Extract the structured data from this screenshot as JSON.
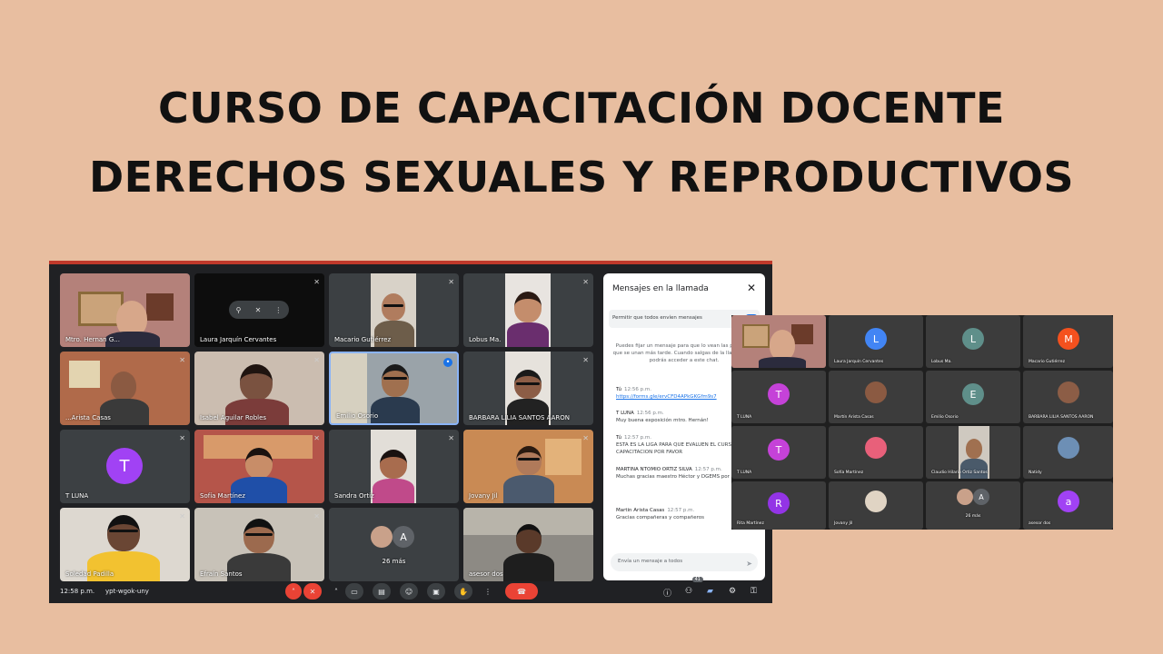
{
  "title_line1": "CURSO DE CAPACITACIÓN DOCENTE",
  "title_line2": "DERECHOS SEXUALES Y REPRODUCTIVOS",
  "meet1": {
    "participants": [
      {
        "name": "Mtro. Hernan G..."
      },
      {
        "name": "Laura Jarquín Cervantes"
      },
      {
        "name": "Macario Gutiérrez"
      },
      {
        "name": "Lobus Ma."
      },
      {
        "name": "...Arista Casas"
      },
      {
        "name": "Isabel Aguilar Robles"
      },
      {
        "name": "Emilio Osorio"
      },
      {
        "name": "BARBARA LILIA SANTOS AARON"
      },
      {
        "name": "T LUNA",
        "initial": "T"
      },
      {
        "name": "Sofía Martínez"
      },
      {
        "name": "Sandra Ortiz"
      },
      {
        "name": "Jovany Jil"
      },
      {
        "name": "Soledad Padilla"
      },
      {
        "name": "Efraín Santos"
      },
      {
        "name": "26 más",
        "initial": "A"
      },
      {
        "name": "asesor dos"
      }
    ],
    "chat": {
      "header": "Mensajes en la llamada",
      "permission": "Permitir que todos envíen mensajes",
      "info": "Puedes fijar un mensaje para que lo vean las personas que se unan más tarde. Cuando salgas de la llamada, no podrás acceder a este chat.",
      "messages": [
        {
          "sender": "Tú",
          "time": "12:56 p.m.",
          "text": "https://forms.gle/ervCFD4APkGKGfm9s7",
          "link": true
        },
        {
          "sender": "T LUNA",
          "time": "12:56 p.m.",
          "text": "Muy buena exposición mtro. Hernán!"
        },
        {
          "sender": "Tú",
          "time": "12:57 p.m.",
          "text": "ESTA ES LA LIGA PARA QUE EVALUEN EL CURSO DE CAPACITACION POR FAVOR"
        },
        {
          "sender": "MARTINA NTOMIO ORTIZ SILVA",
          "time": "12:57 p.m.",
          "text": "Muchas gracias maestro Héctor y DGEMS por su apoyo"
        },
        {
          "sender": "Martin Arista Casas",
          "time": "12:57 p.m.",
          "text": "Gracias compañeras y compañeros"
        }
      ],
      "input_placeholder": "Envía un mensaje a todos"
    },
    "bottom_bar": {
      "time": "12:58 p.m.",
      "meeting_code": "ypt-wgok-uny",
      "participant_count": "41"
    }
  },
  "meet2": {
    "participants": [
      {
        "name": ""
      },
      {
        "name": "Laura Jarquín Cervantes",
        "initial": "L"
      },
      {
        "name": "Lobus Ma.",
        "initial": "L"
      },
      {
        "name": "Macario Gutiérrez",
        "initial": "M"
      },
      {
        "name": "T LUNA",
        "initial": "T"
      },
      {
        "name": "Martín Arista Casas"
      },
      {
        "name": "Emilio Osorio",
        "initial": "E"
      },
      {
        "name": "BARBARA LILIA SANTOS AARON"
      },
      {
        "name": "T LUNA",
        "initial": "T"
      },
      {
        "name": "Sofía Martínez"
      },
      {
        "name": "Claudio Hilario Ortiz Santos"
      },
      {
        "name": "Natidy"
      },
      {
        "name": "Rita Martínez",
        "initial": "R"
      },
      {
        "name": "Jovany Jil"
      },
      {
        "name": "26 más",
        "initial": "A"
      },
      {
        "name": "asesor dos",
        "initial": "a"
      }
    ]
  },
  "colors": {
    "background": "#e8bea0",
    "meet_dark": "#202124",
    "tile": "#3c4043",
    "accent_blue": "#1a73e8",
    "end_call_red": "#ea4335"
  }
}
